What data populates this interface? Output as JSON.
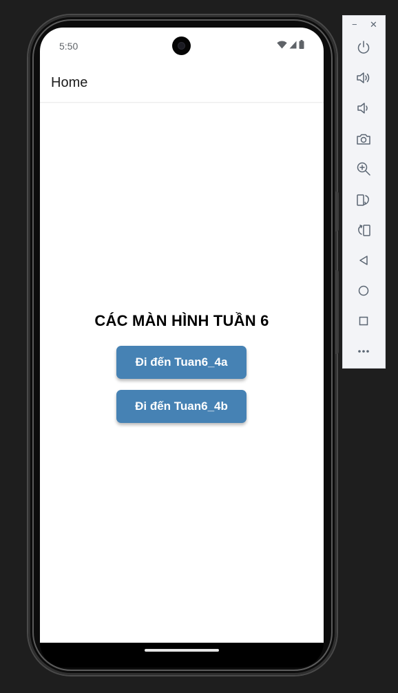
{
  "status_bar": {
    "time": "5:50",
    "icons": [
      "wifi-icon",
      "cellular-signal-icon",
      "battery-icon"
    ]
  },
  "app_bar": {
    "title": "Home"
  },
  "main": {
    "heading": "CÁC MÀN HÌNH TUẦN 6",
    "buttons": [
      {
        "label": "Đi đến Tuan6_4a"
      },
      {
        "label": "Đi đến Tuan6_4b"
      }
    ]
  },
  "emulator_toolbar": {
    "window_controls": [
      "−",
      "✕"
    ],
    "items": [
      "power-icon",
      "volume-up-icon",
      "volume-down-icon",
      "camera-icon",
      "zoom-icon",
      "rotate-left-icon",
      "rotate-right-icon",
      "back-icon",
      "home-icon",
      "overview-icon",
      "more-icon"
    ]
  },
  "colors": {
    "button": "#4682b4",
    "background": "#1e1e1e",
    "screen": "#ffffff",
    "toolbar": "#f3f4f7",
    "toolbar_icon": "#5a6572"
  }
}
